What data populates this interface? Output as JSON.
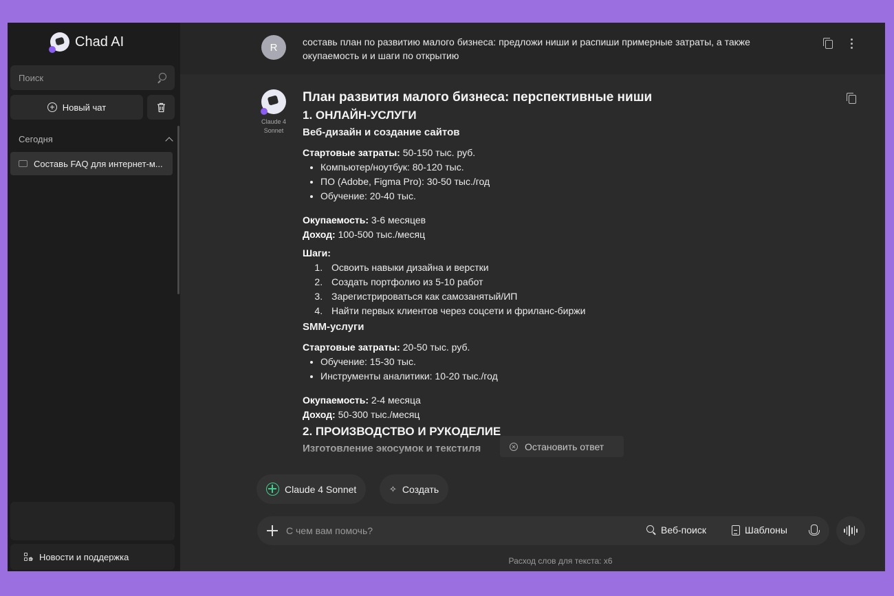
{
  "app": {
    "name": "Chad AI"
  },
  "sidebar": {
    "search_placeholder": "Поиск",
    "new_chat_label": "Новый чат",
    "section_today": "Сегодня",
    "chats": [
      {
        "title": "Составь FAQ для интернет-м..."
      }
    ],
    "news_label": "Новости и поддержка"
  },
  "conversation": {
    "user": {
      "avatar_letter": "R",
      "message": "составь план по развитию малого бизнеса: предложи ниши и распиши примерные затраты, а также окупаемость и и шаги по открытию"
    },
    "assistant": {
      "model_label_line1": "Claude 4",
      "model_label_line2": "Sonnet",
      "title": "План развития малого бизнеса: перспективные ниши",
      "section1": "1. ОНЛАЙН-УСЛУГИ",
      "web": {
        "heading": "Веб-дизайн и создание сайтов",
        "costs_label": "Стартовые затраты:",
        "costs_value": " 50-150 тыс. руб.",
        "cost_items": [
          "Компьютер/ноутбук: 80-120 тыс.",
          "ПО (Adobe, Figma Pro): 30-50 тыс./год",
          "Обучение: 20-40 тыс."
        ],
        "payback_label": "Окупаемость:",
        "payback_value": " 3-6 месяцев",
        "income_label": "Доход:",
        "income_value": " 100-500 тыс./месяц",
        "steps_label": "Шаги:",
        "steps": [
          "Освоить навыки дизайна и верстки",
          "Создать портфолио из 5-10 работ",
          "Зарегистрироваться как самозанятый/ИП",
          "Найти первых клиентов через соцсети и фриланс-биржи"
        ]
      },
      "smm": {
        "heading": "SMM-услуги",
        "costs_label": "Стартовые затраты:",
        "costs_value": " 20-50 тыс. руб.",
        "cost_items": [
          "Обучение: 15-30 тыс.",
          "Инструменты аналитики: 10-20 тыс./год"
        ],
        "payback_label": "Окупаемость:",
        "payback_value": " 2-4 месяца",
        "income_label": "Доход:",
        "income_value": " 50-300 тыс./месяц"
      },
      "section2": "2. ПРОИЗВОДСТВО И РУКОДЕЛИЕ",
      "section2_sub": "Изготовление экосумок и текстиля"
    }
  },
  "stop_label": "Остановить ответ",
  "composer": {
    "model_pill": "Claude 4 Sonnet",
    "create_pill": "Создать",
    "placeholder": "С чем вам помочь?",
    "web_search": "Веб-поиск",
    "templates": "Шаблоны",
    "footer_note": "Расход слов для текста: x6"
  },
  "colors": {
    "background": "#9b6fe0",
    "sidebar": "#1c1c1c",
    "main": "#2b2b2b",
    "accent": "#3ecf8e",
    "brand": "#8a5cf0"
  }
}
